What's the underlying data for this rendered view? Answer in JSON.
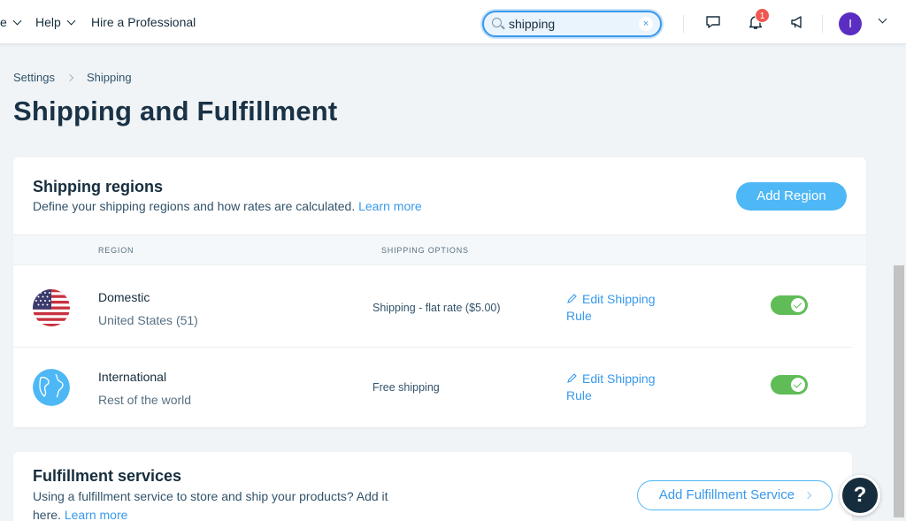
{
  "topbar": {
    "menu_partial": "e",
    "help_label": "Help",
    "hire_label": "Hire a Professional",
    "search_value": "shipping",
    "notification_count": "1",
    "avatar_initial": "I"
  },
  "breadcrumb": {
    "root": "Settings",
    "current": "Shipping"
  },
  "page_title": "Shipping and Fulfillment",
  "regions": {
    "title": "Shipping regions",
    "subtitle": "Define your shipping regions and how rates are calculated.",
    "learn_more": "Learn more",
    "add_button": "Add Region",
    "col_region": "REGION",
    "col_options": "SHIPPING OPTIONS",
    "rows": [
      {
        "name": "Domestic",
        "sub": "United States (51)",
        "option": "Shipping - flat rate  ($5.00)",
        "edit_line1": "Edit Shipping",
        "edit_line2": "Rule"
      },
      {
        "name": "International",
        "sub": "Rest of the world",
        "option": "Free shipping",
        "edit_line1": "Edit Shipping",
        "edit_line2": "Rule"
      }
    ]
  },
  "fulfillment": {
    "title": "Fulfillment services",
    "subtitle_line1": "Using a fulfillment service to store and ship your products? Add it",
    "subtitle_line2": "here.",
    "learn_more": "Learn more",
    "add_button": "Add Fulfillment Service"
  },
  "help_button": "?",
  "colors": {
    "accent": "#3899ec",
    "button": "#4eb7f5",
    "toggle_on": "#60bc57",
    "title": "#162d3d"
  }
}
